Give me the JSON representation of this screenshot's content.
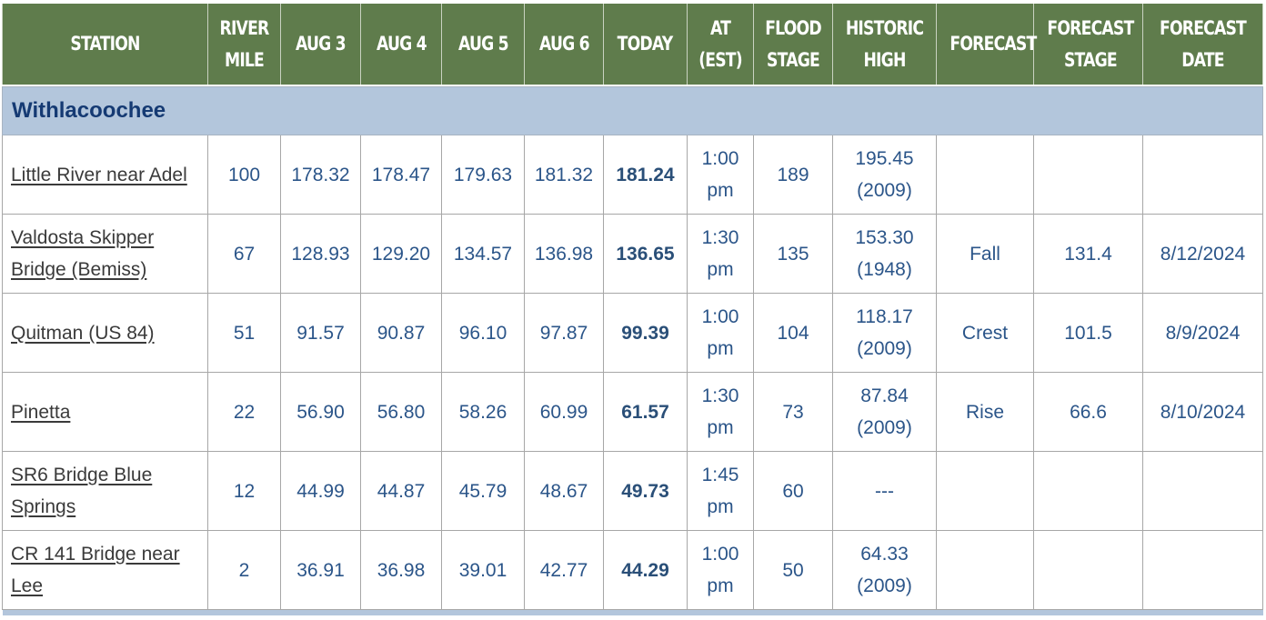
{
  "columns": [
    "STATION",
    "RIVER MILE",
    "AUG 3",
    "AUG 4",
    "AUG 5",
    "AUG 6",
    "TODAY",
    "AT (EST)",
    "FLOOD STAGE",
    "HISTORIC HIGH",
    "FORECAST",
    "FORECAST STAGE",
    "FORECAST DATE"
  ],
  "section": "Withlacoochee",
  "rows": [
    {
      "station": "Little River near Adel",
      "mile": "100",
      "aug3": "178.32",
      "aug4": "178.47",
      "aug5": "179.63",
      "aug6": "181.32",
      "today": "181.24",
      "at": "1:00 pm",
      "flood": "189",
      "historic": "195.45 (2009)",
      "forecast": "",
      "fstage": "",
      "fdate": ""
    },
    {
      "station": "Valdosta Skipper Bridge (Bemiss)",
      "mile": "67",
      "aug3": "128.93",
      "aug4": "129.20",
      "aug5": "134.57",
      "aug6": "136.98",
      "today": "136.65",
      "at": "1:30 pm",
      "flood": "135",
      "historic": "153.30 (1948)",
      "forecast": "Fall",
      "fstage": "131.4",
      "fdate": "8/12/2024"
    },
    {
      "station": "Quitman (US 84)",
      "mile": "51",
      "aug3": "91.57",
      "aug4": "90.87",
      "aug5": "96.10",
      "aug6": "97.87",
      "today": "99.39",
      "at": "1:00 pm",
      "flood": "104",
      "historic": "118.17 (2009)",
      "forecast": "Crest",
      "fstage": "101.5",
      "fdate": "8/9/2024"
    },
    {
      "station": "Pinetta",
      "mile": "22",
      "aug3": "56.90",
      "aug4": "56.80",
      "aug5": "58.26",
      "aug6": "60.99",
      "today": "61.57",
      "at": "1:30 pm",
      "flood": "73",
      "historic": "87.84 (2009)",
      "forecast": "Rise",
      "fstage": "66.6",
      "fdate": "8/10/2024"
    },
    {
      "station": "SR6 Bridge Blue Springs",
      "mile": "12",
      "aug3": "44.99",
      "aug4": "44.87",
      "aug5": "45.79",
      "aug6": "48.67",
      "today": "49.73",
      "at": "1:45 pm",
      "flood": "60",
      "historic": "---",
      "forecast": "",
      "fstage": "",
      "fdate": ""
    },
    {
      "station": "CR 141 Bridge near Lee",
      "mile": "2",
      "aug3": "36.91",
      "aug4": "36.98",
      "aug5": "39.01",
      "aug6": "42.77",
      "today": "44.29",
      "at": "1:00 pm",
      "flood": "50",
      "historic": "64.33 (2009)",
      "forecast": "",
      "fstage": "",
      "fdate": ""
    }
  ]
}
